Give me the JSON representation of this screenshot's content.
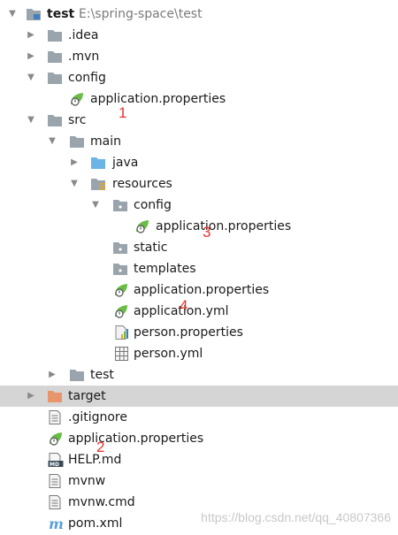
{
  "project": {
    "name": "test",
    "path": "E:\\spring-space\\test"
  },
  "tree": {
    "idea": ".idea",
    "mvn": ".mvn",
    "config": "config",
    "config_app_props": "application.properties",
    "src": "src",
    "main": "main",
    "java": "java",
    "resources": "resources",
    "res_config": "config",
    "res_config_app_props": "application.properties",
    "static": "static",
    "templates": "templates",
    "res_app_props": "application.properties",
    "res_app_yml": "application.yml",
    "person_props": "person.properties",
    "person_yml": "person.yml",
    "test": "test",
    "target": "target",
    "gitignore": ".gitignore",
    "root_app_props": "application.properties",
    "help_md": "HELP.md",
    "mvnw": "mvnw",
    "mvnw_cmd": "mvnw.cmd",
    "pom_xml": "pom.xml"
  },
  "annotations": {
    "one": "1",
    "two": "2",
    "three": "3",
    "four": "4"
  },
  "watermark": "https://blog.csdn.net/qq_40807366",
  "colors": {
    "folder": "#9aa4ad",
    "source_folder": "#6cb4e6",
    "excluded_folder": "#e8956b",
    "spring_leaf": "#6abd45",
    "annotation": "#e8322e",
    "selection": "#d5d5d5"
  }
}
